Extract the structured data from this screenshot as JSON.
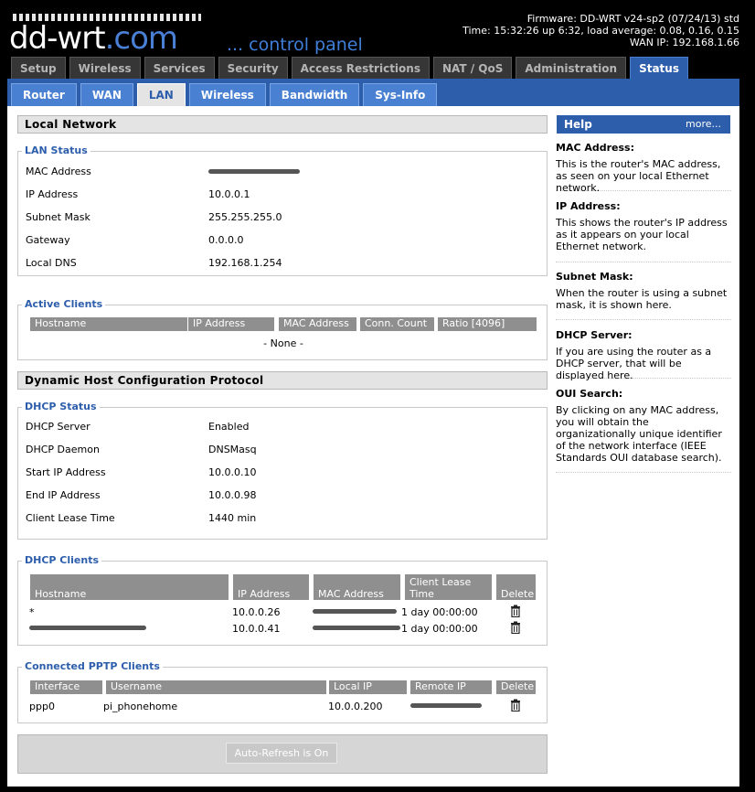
{
  "header": {
    "logo_text": "dd-wrt",
    "logo_com": ".com",
    "logo_sub": "... control panel",
    "firmware": "Firmware: DD-WRT v24-sp2 (07/24/13) std",
    "time": "Time: 15:32:26 up 6:32, load average: 0.08, 0.16, 0.15",
    "wan_ip": "WAN IP: 192.168.1.66"
  },
  "top_tabs": [
    "Setup",
    "Wireless",
    "Services",
    "Security",
    "Access Restrictions",
    "NAT / QoS",
    "Administration",
    "Status"
  ],
  "sub_tabs": [
    "Router",
    "WAN",
    "LAN",
    "Wireless",
    "Bandwidth",
    "Sys-Info"
  ],
  "local_network": {
    "title": "Local Network",
    "lan_status": {
      "legend": "LAN Status",
      "rows": [
        {
          "label": "MAC Address",
          "value": ""
        },
        {
          "label": "IP Address",
          "value": "10.0.0.1"
        },
        {
          "label": "Subnet Mask",
          "value": "255.255.255.0"
        },
        {
          "label": "Gateway",
          "value": "0.0.0.0"
        },
        {
          "label": "Local DNS",
          "value": "192.168.1.254"
        }
      ]
    },
    "active_clients": {
      "legend": "Active Clients",
      "headers": [
        "Hostname",
        "IP Address",
        "MAC Address",
        "Conn. Count",
        "Ratio [4096]"
      ],
      "empty": "- None -"
    }
  },
  "dhcp": {
    "title": "Dynamic Host Configuration Protocol",
    "status": {
      "legend": "DHCP Status",
      "rows": [
        {
          "label": "DHCP Server",
          "value": "Enabled"
        },
        {
          "label": "DHCP Daemon",
          "value": "DNSMasq"
        },
        {
          "label": "Start IP Address",
          "value": "10.0.0.10"
        },
        {
          "label": "End IP Address",
          "value": "10.0.0.98"
        },
        {
          "label": "Client Lease Time",
          "value": "1440 min"
        }
      ]
    },
    "clients": {
      "legend": "DHCP Clients",
      "headers": [
        "Hostname",
        "IP Address",
        "MAC Address",
        "Client Lease Time",
        "Delete"
      ],
      "rows": [
        {
          "hostname": "*",
          "ip": "10.0.0.26",
          "lease": "1 day 00:00:00"
        },
        {
          "hostname": "",
          "ip": "10.0.0.41",
          "lease": "1 day 00:00:00"
        }
      ]
    },
    "pptp": {
      "legend": "Connected PPTP Clients",
      "headers": [
        "Interface",
        "Username",
        "Local IP",
        "Remote IP",
        "Delete"
      ],
      "rows": [
        {
          "interface": "ppp0",
          "username": "pi_phonehome",
          "local_ip": "10.0.0.200"
        }
      ]
    }
  },
  "refresh_button": "Auto-Refresh is On",
  "help": {
    "title": "Help",
    "more": "more...",
    "items": [
      {
        "title": "MAC Address:",
        "text": "This is the router's MAC address, as seen on your local Ethernet network."
      },
      {
        "title": "IP Address:",
        "text": "This shows the router's IP address as it appears on your local Ethernet network."
      },
      {
        "title": "Subnet Mask:",
        "text": "When the router is using a subnet mask, it is shown here."
      },
      {
        "title": "DHCP Server:",
        "text": "If you are using the router as a DHCP server, that will be displayed here."
      },
      {
        "title": "OUI Search:",
        "text": "By clicking on any MAC address, you will obtain the organizationally unique identifier of the network interface (IEEE Standards OUI database search)."
      }
    ]
  },
  "colors": {
    "accent": "#2d5eab",
    "subtab": "#4a80d2",
    "header_bg": "#000000"
  }
}
